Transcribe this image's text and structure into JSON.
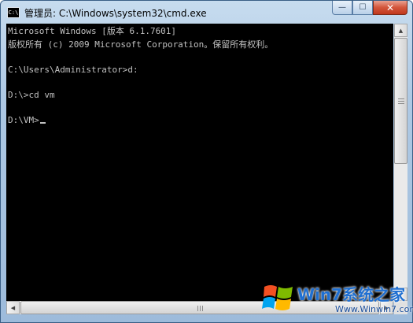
{
  "window": {
    "title": "管理员: C:\\Windows\\system32\\cmd.exe",
    "icon_label": "C:\\",
    "controls": {
      "minimize": "—",
      "maximize": "☐",
      "close": "✕"
    }
  },
  "console": {
    "lines": [
      "Microsoft Windows [版本 6.1.7601]",
      "版权所有 (c) 2009 Microsoft Corporation。保留所有权利。",
      "",
      "C:\\Users\\Administrator>d:",
      "",
      "D:\\>cd vm",
      "",
      "D:\\VM>"
    ]
  },
  "scrollbars": {
    "up_arrow": "▲",
    "down_arrow": "▼",
    "left_arrow": "◀",
    "right_arrow": "▶"
  },
  "watermark": {
    "brand": "Win7系统之家",
    "url": "Www.Winwin7.com"
  },
  "colors": {
    "console_bg": "#000000",
    "console_text": "#c0c0c0",
    "title_bar": "#aec9e4",
    "close_button": "#c0381d",
    "watermark_blue": "#1f6fd1"
  }
}
